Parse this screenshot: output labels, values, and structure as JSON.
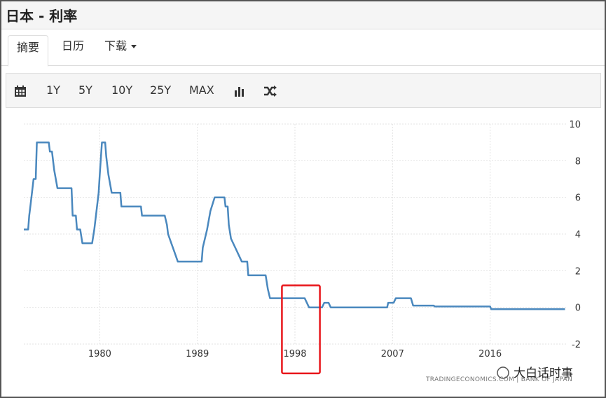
{
  "title": "日本 - 利率",
  "tabs": [
    {
      "label": "摘要"
    },
    {
      "label": "日历"
    },
    {
      "label": "下载"
    }
  ],
  "toolbar": {
    "ranges": [
      "1Y",
      "5Y",
      "10Y",
      "25Y",
      "MAX"
    ]
  },
  "icons": [
    "calendar-icon",
    "bar-chart-icon",
    "shuffle-icon"
  ],
  "watermark": {
    "source": "TRADINGECONOMICS.COM | BANK OF JAPAN",
    "social": "大白话时事"
  },
  "colors": {
    "line": "#4a88be",
    "highlight": "#e8161b",
    "grid": "#e3e3e3"
  },
  "chart_data": {
    "type": "line",
    "x_ticks": [
      1980,
      1989,
      1998,
      2007,
      2016
    ],
    "y_ticks": [
      10,
      8,
      6,
      4,
      2,
      0,
      -2
    ],
    "xlim": [
      1973.0,
      2023.0
    ],
    "ylim": [
      -2,
      10
    ],
    "grid": true,
    "series": [
      {
        "values": [
          [
            1973.0,
            4.25
          ],
          [
            1973.4,
            4.25
          ],
          [
            1973.5,
            5.0
          ],
          [
            1973.6,
            5.5
          ],
          [
            1973.8,
            6.5
          ],
          [
            1973.9,
            7.0
          ],
          [
            1974.1,
            7.0
          ],
          [
            1974.2,
            9.0
          ],
          [
            1975.3,
            9.0
          ],
          [
            1975.4,
            8.5
          ],
          [
            1975.6,
            8.5
          ],
          [
            1975.8,
            7.5
          ],
          [
            1976.1,
            6.5
          ],
          [
            1977.4,
            6.5
          ],
          [
            1977.5,
            5.0
          ],
          [
            1977.8,
            5.0
          ],
          [
            1977.9,
            4.25
          ],
          [
            1978.2,
            4.25
          ],
          [
            1978.4,
            3.5
          ],
          [
            1979.3,
            3.5
          ],
          [
            1979.5,
            4.25
          ],
          [
            1979.7,
            5.25
          ],
          [
            1979.9,
            6.25
          ],
          [
            1980.0,
            7.25
          ],
          [
            1980.2,
            9.0
          ],
          [
            1980.5,
            9.0
          ],
          [
            1980.6,
            8.25
          ],
          [
            1980.8,
            7.25
          ],
          [
            1981.1,
            6.25
          ],
          [
            1981.9,
            6.25
          ],
          [
            1982.0,
            5.5
          ],
          [
            1983.8,
            5.5
          ],
          [
            1983.9,
            5.0
          ],
          [
            1986.0,
            5.0
          ],
          [
            1986.2,
            4.5
          ],
          [
            1986.3,
            4.0
          ],
          [
            1986.6,
            3.5
          ],
          [
            1986.9,
            3.0
          ],
          [
            1987.2,
            2.5
          ],
          [
            1989.4,
            2.5
          ],
          [
            1989.5,
            3.25
          ],
          [
            1989.9,
            4.25
          ],
          [
            1990.2,
            5.25
          ],
          [
            1990.6,
            6.0
          ],
          [
            1991.5,
            6.0
          ],
          [
            1991.6,
            5.5
          ],
          [
            1991.8,
            5.5
          ],
          [
            1991.9,
            4.5
          ],
          [
            1992.1,
            3.75
          ],
          [
            1992.5,
            3.25
          ],
          [
            1993.1,
            2.5
          ],
          [
            1993.6,
            2.5
          ],
          [
            1993.7,
            1.75
          ],
          [
            1995.3,
            1.75
          ],
          [
            1995.5,
            1.0
          ],
          [
            1995.7,
            0.5
          ],
          [
            1998.9,
            0.5
          ],
          [
            1999.1,
            0.25
          ],
          [
            1999.3,
            0.0
          ],
          [
            2000.5,
            0.0
          ],
          [
            2000.7,
            0.25
          ],
          [
            2001.1,
            0.25
          ],
          [
            2001.3,
            0.0
          ],
          [
            2006.5,
            0.0
          ],
          [
            2006.6,
            0.25
          ],
          [
            2007.1,
            0.25
          ],
          [
            2007.3,
            0.5
          ],
          [
            2008.7,
            0.5
          ],
          [
            2008.9,
            0.1
          ],
          [
            2010.8,
            0.1
          ],
          [
            2010.9,
            0.05
          ],
          [
            2016.0,
            0.05
          ],
          [
            2016.1,
            -0.1
          ],
          [
            2022.9,
            -0.1
          ]
        ]
      }
    ],
    "annotations": [
      {
        "type": "box",
        "x_range": [
          1996.8,
          2000.3
        ],
        "y_range": [
          -3.6,
          1.2
        ],
        "label": ""
      }
    ]
  }
}
